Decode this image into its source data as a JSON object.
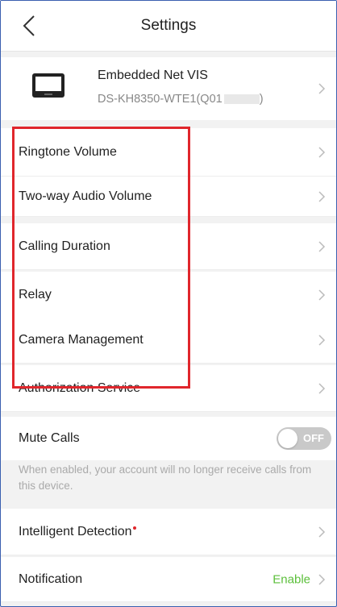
{
  "header": {
    "title": "Settings"
  },
  "device": {
    "name": "Embedded Net VIS",
    "model_prefix": "DS-KH8350-WTE1(Q01",
    "model_suffix": ")"
  },
  "rows": {
    "ringtone_volume": "Ringtone Volume",
    "two_way_audio_volume": "Two-way Audio Volume",
    "calling_duration": "Calling Duration",
    "relay": "Relay",
    "camera_management": "Camera Management",
    "authorization_service": "Authorization Service",
    "mute_calls": "Mute Calls",
    "intelligent_detection": "Intelligent Detection",
    "notification": "Notification"
  },
  "mute_calls": {
    "toggle_state_label": "OFF",
    "note": "When enabled, your account will no longer receive calls from this device."
  },
  "notification": {
    "status": "Enable"
  },
  "colors": {
    "highlight": "#e0262c",
    "enable_green": "#5bbf3a",
    "toggle_off": "#c9c9c9"
  }
}
